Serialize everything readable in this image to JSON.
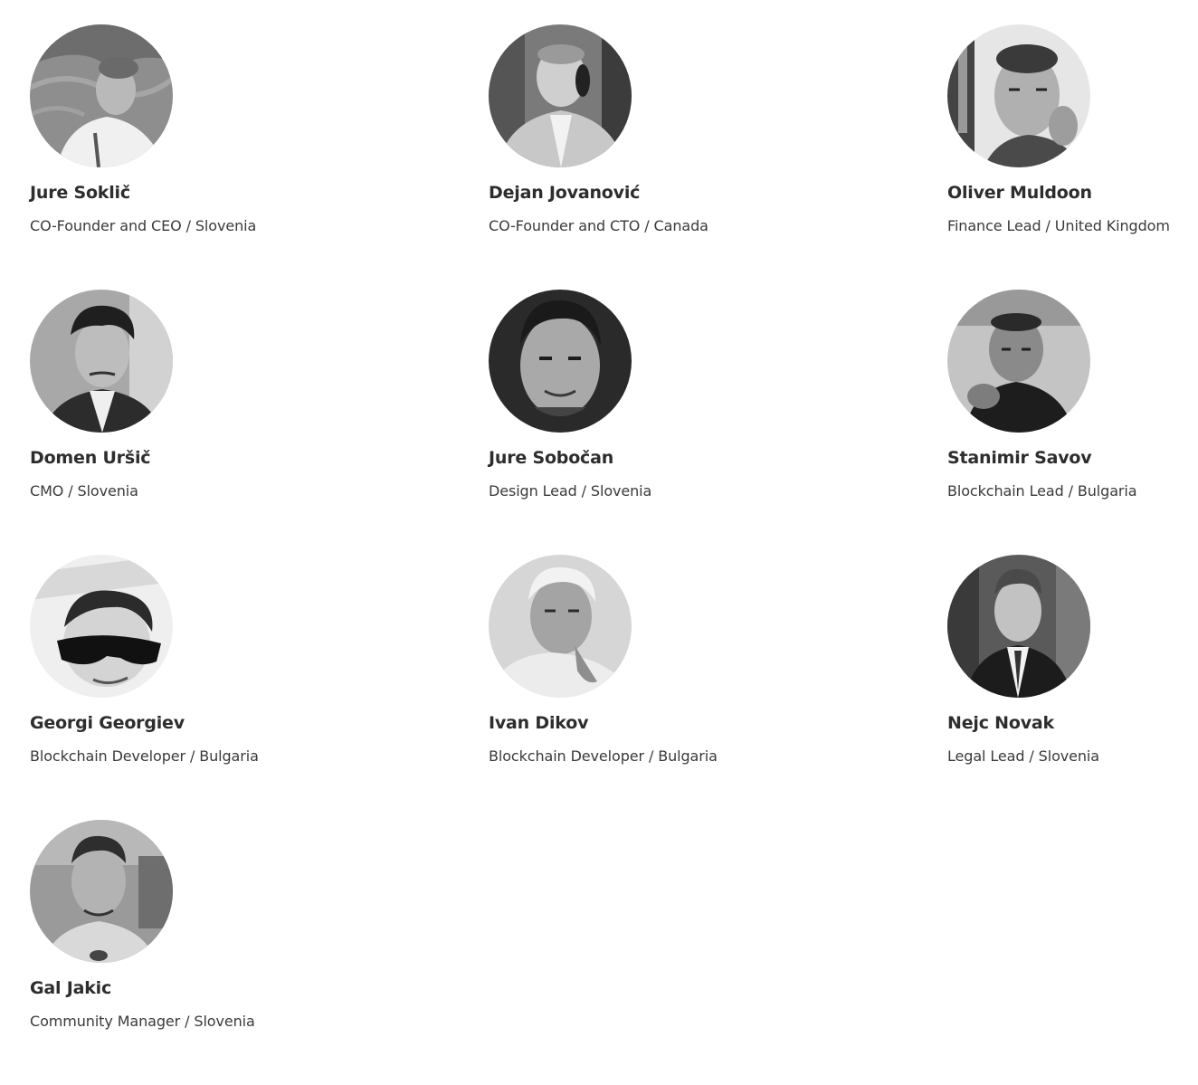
{
  "team": {
    "members": [
      {
        "name": "Jure Soklič",
        "role": "CO-Founder and CEO / Slovenia",
        "photo_tone": "#8a8a8a"
      },
      {
        "name": "Dejan Jovanović",
        "role": "CO-Founder and CTO / Canada",
        "photo_tone": "#9a9a9a"
      },
      {
        "name": "Oliver Muldoon",
        "role": "Finance Lead / United Kingdom",
        "photo_tone": "#b5b5b5"
      },
      {
        "name": "Domen Uršič",
        "role": "CMO / Slovenia",
        "photo_tone": "#7a7a7a"
      },
      {
        "name": "Jure Sobočan",
        "role": "Design Lead / Slovenia",
        "photo_tone": "#5e5e5e"
      },
      {
        "name": "Stanimir Savov",
        "role": "Blockchain Lead / Bulgaria",
        "photo_tone": "#8c8c8c"
      },
      {
        "name": "Georgi Georgiev",
        "role": "Blockchain Developer / Bulgaria",
        "photo_tone": "#c9c9c9"
      },
      {
        "name": "Ivan Dikov",
        "role": "Blockchain Developer / Bulgaria",
        "photo_tone": "#bdbdbd"
      },
      {
        "name": "Nejc Novak",
        "role": "Legal Lead / Slovenia",
        "photo_tone": "#6e6e6e"
      },
      {
        "name": "Gal Jakic",
        "role": "Community Manager / Slovenia",
        "photo_tone": "#8f8f8f"
      }
    ]
  }
}
